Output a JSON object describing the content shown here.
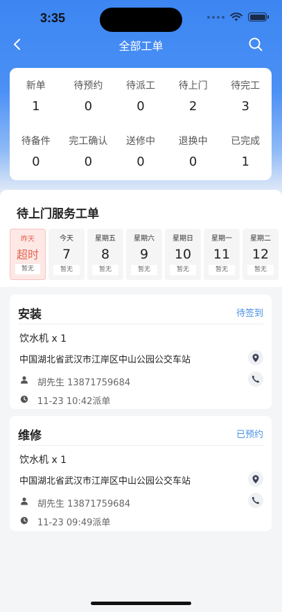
{
  "status_bar": {
    "time": "3:35"
  },
  "nav": {
    "title": "全部工单"
  },
  "summary": {
    "row1": [
      {
        "label": "新单",
        "count": "1"
      },
      {
        "label": "待预约",
        "count": "0"
      },
      {
        "label": "待派工",
        "count": "0"
      },
      {
        "label": "待上门",
        "count": "2"
      },
      {
        "label": "待完工",
        "count": "3"
      }
    ],
    "row2": [
      {
        "label": "待备件",
        "count": "0"
      },
      {
        "label": "完工确认",
        "count": "0"
      },
      {
        "label": "送修中",
        "count": "0"
      },
      {
        "label": "退换中",
        "count": "0"
      },
      {
        "label": "已完成",
        "count": "1"
      }
    ]
  },
  "section": {
    "title": "待上门服务工单"
  },
  "days": [
    {
      "name": "昨天",
      "num": "超时",
      "badge": "暂无",
      "active": true
    },
    {
      "name": "今天",
      "num": "7",
      "badge": "暂无"
    },
    {
      "name": "星期五",
      "num": "8",
      "badge": "暂无"
    },
    {
      "name": "星期六",
      "num": "9",
      "badge": "暂无"
    },
    {
      "name": "星期日",
      "num": "10",
      "badge": "暂无"
    },
    {
      "name": "星期一",
      "num": "11",
      "badge": "暂无"
    },
    {
      "name": "星期二",
      "num": "12",
      "badge": "暂无"
    }
  ],
  "orders": [
    {
      "type": "安装",
      "status": "待签到",
      "product": "饮水机 x 1",
      "address": "中国湖北省武汉市江岸区中山公园公交车站",
      "contact": "胡先生 13871759684",
      "time": "11-23 10:42派单"
    },
    {
      "type": "维修",
      "status": "已预约",
      "product": "饮水机 x 1",
      "address": "中国湖北省武汉市江岸区中山公园公交车站",
      "contact": "胡先生 13871759684",
      "time": "11-23 09:49派单"
    }
  ],
  "colors": {
    "primary": "#3d86f2",
    "status_link": "#4a8fe6",
    "overdue": "#e2644d"
  }
}
